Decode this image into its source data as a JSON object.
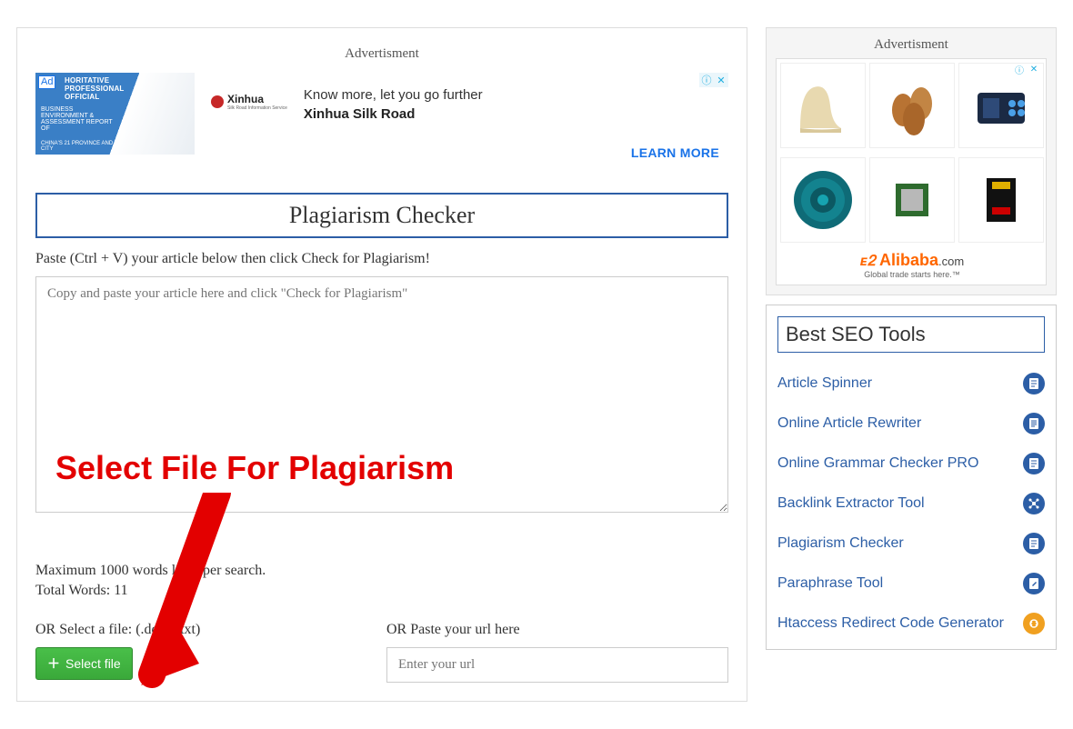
{
  "main": {
    "ad_label": "Advertisment",
    "ad": {
      "badge": "Ad",
      "thumb_line1": "HORITATIVE PROFESSIONAL OFFICIAL",
      "thumb_line2": "BUSINESS ENVIRONMENT & ASSESSMENT REPORT OF",
      "thumb_line3": "CHINA'S 21 PROVINCE AND CITY",
      "brand": "Xinhua",
      "brand_sub": "Silk Road Information Service",
      "headline": "Know more, let you go further",
      "sub": "Xinhua Silk Road",
      "cta": "LEARN MORE"
    },
    "title": "Plagiarism Checker",
    "instruction": "Paste (Ctrl + V) your article below then click Check for Plagiarism!",
    "textarea_placeholder": "Copy and paste your article here and click \"Check for Plagiarism\"",
    "annotation": "Select File For Plagiarism",
    "limit_line": "Maximum 1000 words limit per search.",
    "words_label": "Total Words: ",
    "words_count": "11",
    "file_label": "OR Select a file: (.docx/.txt)",
    "select_file_btn": "Select file",
    "url_label": "OR Paste your url here",
    "url_placeholder": "Enter your url"
  },
  "sidebar": {
    "ad_label": "Advertisment",
    "alibaba_brand": "Alibaba",
    "alibaba_com": ".com",
    "alibaba_tag": "Global trade starts here.™",
    "tools_title": "Best SEO Tools",
    "tools": [
      {
        "label": "Article Spinner",
        "color": "#2c5ea6",
        "icon": "page"
      },
      {
        "label": "Online Article Rewriter",
        "color": "#2c5ea6",
        "icon": "doc"
      },
      {
        "label": "Online Grammar Checker PRO",
        "color": "#2c5ea6",
        "icon": "page"
      },
      {
        "label": "Backlink Extractor Tool",
        "color": "#2c5ea6",
        "icon": "net"
      },
      {
        "label": "Plagiarism Checker",
        "color": "#2c5ea6",
        "icon": "page"
      },
      {
        "label": "Paraphrase Tool",
        "color": "#2c5ea6",
        "icon": "pencil"
      },
      {
        "label": "Htaccess Redirect Code Generator",
        "color": "#f0a020",
        "icon": "redir"
      }
    ]
  }
}
